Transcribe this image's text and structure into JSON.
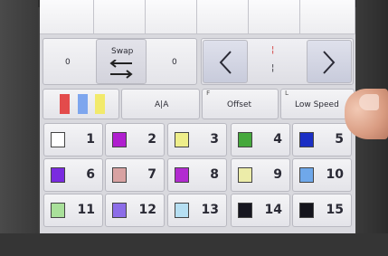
{
  "swap": {
    "left_value": "0",
    "right_value": "0",
    "label": "Swap"
  },
  "nav": {
    "prev": "<",
    "next": ">"
  },
  "bars": {
    "colors": [
      "#e34b4b",
      "#7ea6ee",
      "#f2ea6c"
    ]
  },
  "function_row": {
    "mode_label": "A|A",
    "offset_key": "F",
    "offset_label": "Offset",
    "speed_key": "L",
    "speed_label": "Low Speed"
  },
  "colors": [
    {
      "number": "1",
      "color": "#ffffff"
    },
    {
      "number": "2",
      "color": "#b01fcf"
    },
    {
      "number": "3",
      "color": "#eeee8a"
    },
    {
      "number": "4",
      "color": "#45a83c"
    },
    {
      "number": "5",
      "color": "#1b2fc4"
    },
    {
      "number": "6",
      "color": "#7a2be0"
    },
    {
      "number": "7",
      "color": "#d8a2a2"
    },
    {
      "number": "8",
      "color": "#b22bd0"
    },
    {
      "number": "9",
      "color": "#ececa9"
    },
    {
      "number": "10",
      "color": "#6fa8ea"
    },
    {
      "number": "11",
      "color": "#a9e09a"
    },
    {
      "number": "12",
      "color": "#8c6de8"
    },
    {
      "number": "13",
      "color": "#b6dff2"
    },
    {
      "number": "14",
      "color": "#161620"
    },
    {
      "number": "15",
      "color": "#14141c"
    }
  ]
}
